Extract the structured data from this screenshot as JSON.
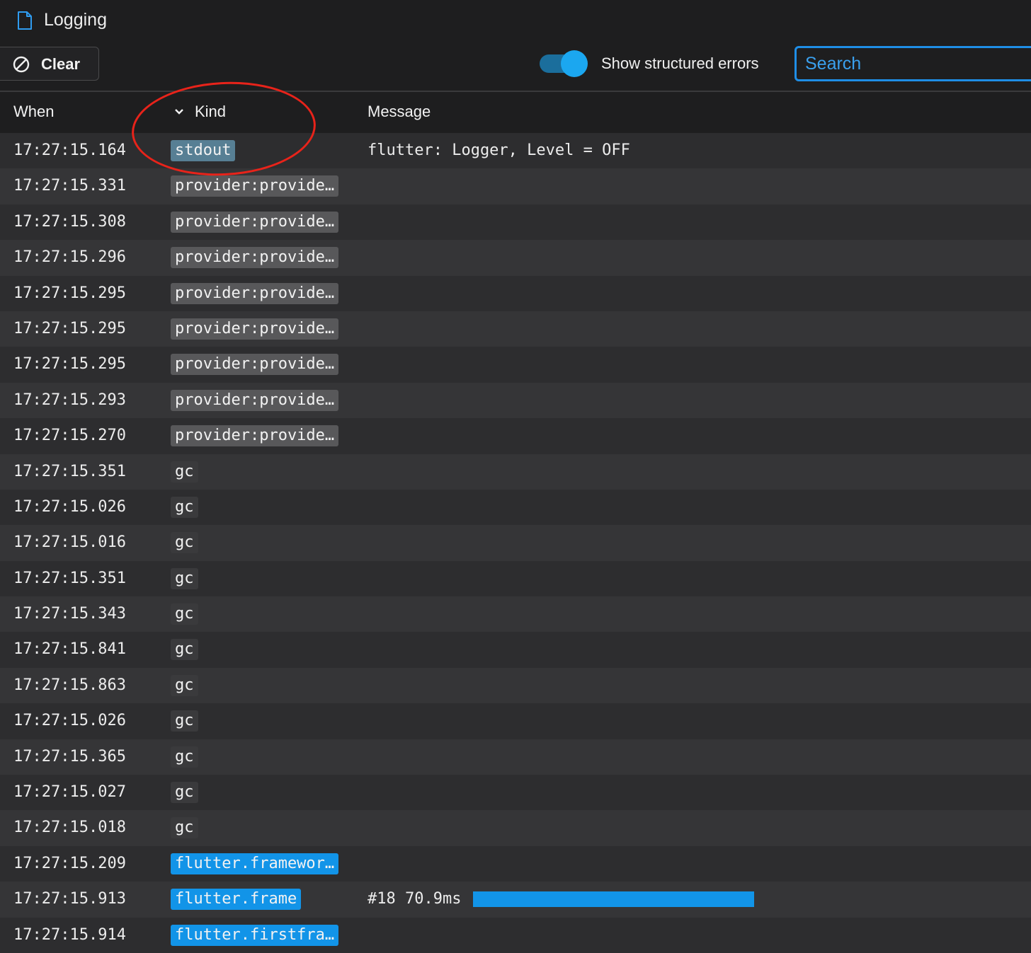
{
  "app": {
    "title": "Logging",
    "icon": "file-icon"
  },
  "toolbar": {
    "clear_label": "Clear",
    "clear_icon": "block-icon",
    "toggle_label": "Show structured errors",
    "toggle_on": true,
    "search_placeholder": "Search"
  },
  "columns": {
    "when": "When",
    "kind": "Kind",
    "message": "Message"
  },
  "colors": {
    "gc": "#3a3a3c",
    "provider": "#58585a",
    "stdout": "#577f94",
    "flutter": "#1294e8",
    "accent": "#1ba7f0",
    "annotation": "#e8231a"
  },
  "rows": [
    {
      "when": "17:27:15.164",
      "kind": "stdout",
      "kind_type": "stdout",
      "message": "flutter: Logger, Level = OFF"
    },
    {
      "when": "17:27:15.331",
      "kind": "provider:provide…",
      "kind_type": "provider",
      "message": ""
    },
    {
      "when": "17:27:15.308",
      "kind": "provider:provide…",
      "kind_type": "provider",
      "message": ""
    },
    {
      "when": "17:27:15.296",
      "kind": "provider:provide…",
      "kind_type": "provider",
      "message": ""
    },
    {
      "when": "17:27:15.295",
      "kind": "provider:provide…",
      "kind_type": "provider",
      "message": ""
    },
    {
      "when": "17:27:15.295",
      "kind": "provider:provide…",
      "kind_type": "provider",
      "message": ""
    },
    {
      "when": "17:27:15.295",
      "kind": "provider:provide…",
      "kind_type": "provider",
      "message": ""
    },
    {
      "when": "17:27:15.293",
      "kind": "provider:provide…",
      "kind_type": "provider",
      "message": ""
    },
    {
      "when": "17:27:15.270",
      "kind": "provider:provide…",
      "kind_type": "provider",
      "message": ""
    },
    {
      "when": "17:27:15.351",
      "kind": "gc",
      "kind_type": "gc",
      "message": ""
    },
    {
      "when": "17:27:15.026",
      "kind": "gc",
      "kind_type": "gc",
      "message": ""
    },
    {
      "when": "17:27:15.016",
      "kind": "gc",
      "kind_type": "gc",
      "message": ""
    },
    {
      "when": "17:27:15.351",
      "kind": "gc",
      "kind_type": "gc",
      "message": ""
    },
    {
      "when": "17:27:15.343",
      "kind": "gc",
      "kind_type": "gc",
      "message": ""
    },
    {
      "when": "17:27:15.841",
      "kind": "gc",
      "kind_type": "gc",
      "message": ""
    },
    {
      "when": "17:27:15.863",
      "kind": "gc",
      "kind_type": "gc",
      "message": ""
    },
    {
      "when": "17:27:15.026",
      "kind": "gc",
      "kind_type": "gc",
      "message": ""
    },
    {
      "when": "17:27:15.365",
      "kind": "gc",
      "kind_type": "gc",
      "message": ""
    },
    {
      "when": "17:27:15.027",
      "kind": "gc",
      "kind_type": "gc",
      "message": ""
    },
    {
      "when": "17:27:15.018",
      "kind": "gc",
      "kind_type": "gc",
      "message": ""
    },
    {
      "when": "17:27:15.209",
      "kind": "flutter.framewor…",
      "kind_type": "flutter",
      "message": ""
    },
    {
      "when": "17:27:15.913",
      "kind": "flutter.frame",
      "kind_type": "flutter",
      "message": "#18 70.9ms",
      "frame_ms": 70.9
    },
    {
      "when": "17:27:15.914",
      "kind": "flutter.firstfra…",
      "kind_type": "flutter",
      "message": ""
    }
  ]
}
